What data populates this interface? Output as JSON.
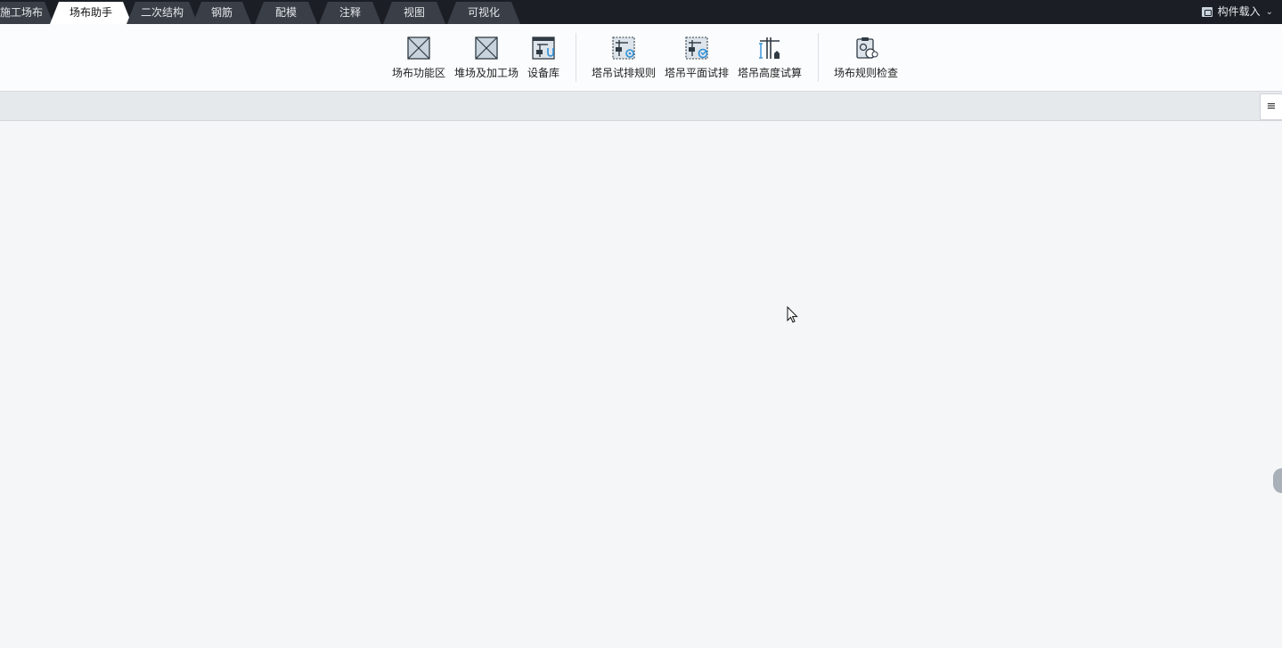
{
  "tabs": [
    {
      "label": "施工场布",
      "active": false
    },
    {
      "label": "场布助手",
      "active": true
    },
    {
      "label": "二次结构",
      "active": false
    },
    {
      "label": "钢筋",
      "active": false
    },
    {
      "label": "配模",
      "active": false
    },
    {
      "label": "注释",
      "active": false
    },
    {
      "label": "视图",
      "active": false
    },
    {
      "label": "可视化",
      "active": false
    }
  ],
  "header_right": {
    "load_label": "构件载入"
  },
  "ribbon": {
    "items": [
      {
        "label": "场布功能区",
        "icon": "box-x-icon"
      },
      {
        "label": "堆场及加工场",
        "icon": "box-x-icon"
      },
      {
        "label": "设备库",
        "icon": "equipment-library-icon"
      },
      {
        "label": "塔吊试排规则",
        "icon": "crane-rule-icon"
      },
      {
        "label": "塔吊平面试排",
        "icon": "crane-plan-icon"
      },
      {
        "label": "塔吊高度试算",
        "icon": "crane-height-icon"
      },
      {
        "label": "场布规则检查",
        "icon": "rule-check-icon"
      }
    ]
  },
  "subbar": {
    "menu_glyph": "≡"
  },
  "colors": {
    "tabbar_bg": "#1b1f25",
    "tab_bg": "#3a3f47",
    "accent": "#2f8fd8"
  }
}
